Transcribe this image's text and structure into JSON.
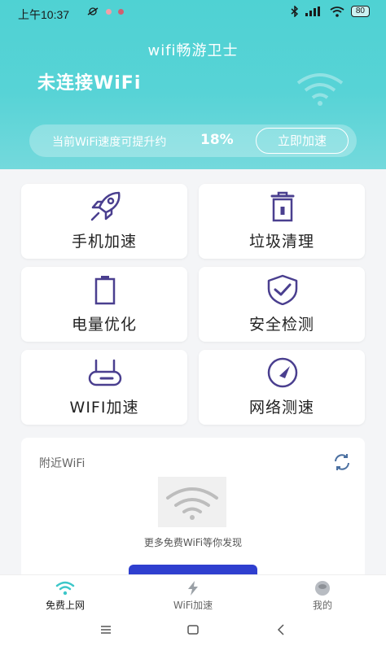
{
  "status_bar": {
    "time": "上午10:37",
    "battery": "80"
  },
  "header": {
    "app_title": "wifi畅游卫士",
    "wifi_status": "未连接WiFi",
    "speed_text": "当前WiFi速度可提升约",
    "speed_percent": "18%",
    "boost_button": "立即加速"
  },
  "features": [
    {
      "label": "手机加速",
      "icon": "rocket-icon"
    },
    {
      "label": "垃圾清理",
      "icon": "trash-icon"
    },
    {
      "label": "电量优化",
      "icon": "battery-icon"
    },
    {
      "label": "安全检测",
      "icon": "shield-check-icon"
    },
    {
      "label": "WIFI加速",
      "icon": "router-icon"
    },
    {
      "label": "网络测速",
      "icon": "speedometer-icon"
    }
  ],
  "nearby": {
    "title": "附近WiFi",
    "empty_text": "更多免费WiFi等你发现"
  },
  "bottom_nav": [
    {
      "label": "免费上网",
      "icon": "wifi-icon",
      "active": true
    },
    {
      "label": "WiFi加速",
      "icon": "lightning-icon",
      "active": false
    },
    {
      "label": "我的",
      "icon": "profile-icon",
      "active": false
    }
  ],
  "colors": {
    "header_gradient_top": "#4fd2d3",
    "accent_purple": "#4a3f8f",
    "button_blue": "#2f3fcf"
  }
}
